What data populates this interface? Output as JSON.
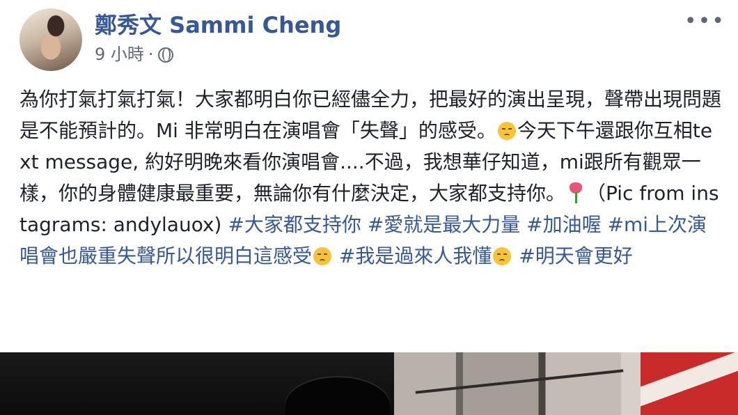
{
  "post": {
    "author": "鄭秀文 Sammi Cheng",
    "time": "9 小時",
    "separator": "·",
    "visibility_icon": "globe-icon",
    "more_label": "•••",
    "text": {
      "seg1": "為你打氣打氣打氣！大家都明白你已經儘全力，把最好的演出呈現，聲帶出現問題是不能預計的。Mi 非常明白在演唱會「失聲」的感受。",
      "seg2": "今天下午還跟你互相text message, 約好明晚來看你演唱會....不過，我想華仔知道，mi跟所有觀眾一樣，你的身體健康最重要，無論你有什麼決定，大家都支持你。",
      "seg3": "（Pic from instagrams: andylauox) ",
      "tag1": "#大家都支持你",
      "tag2": "#愛就是最大力量",
      "tag3": "#加油喔",
      "tag4": "#mi上次演唱會也嚴重失聲所以很明白這感受",
      "tag5": "#我是過來人我懂",
      "tag6": "#明天會更好"
    }
  },
  "icons": {
    "sad": "sad-face-emoji-icon",
    "tulip": "tulip-emoji-icon"
  }
}
